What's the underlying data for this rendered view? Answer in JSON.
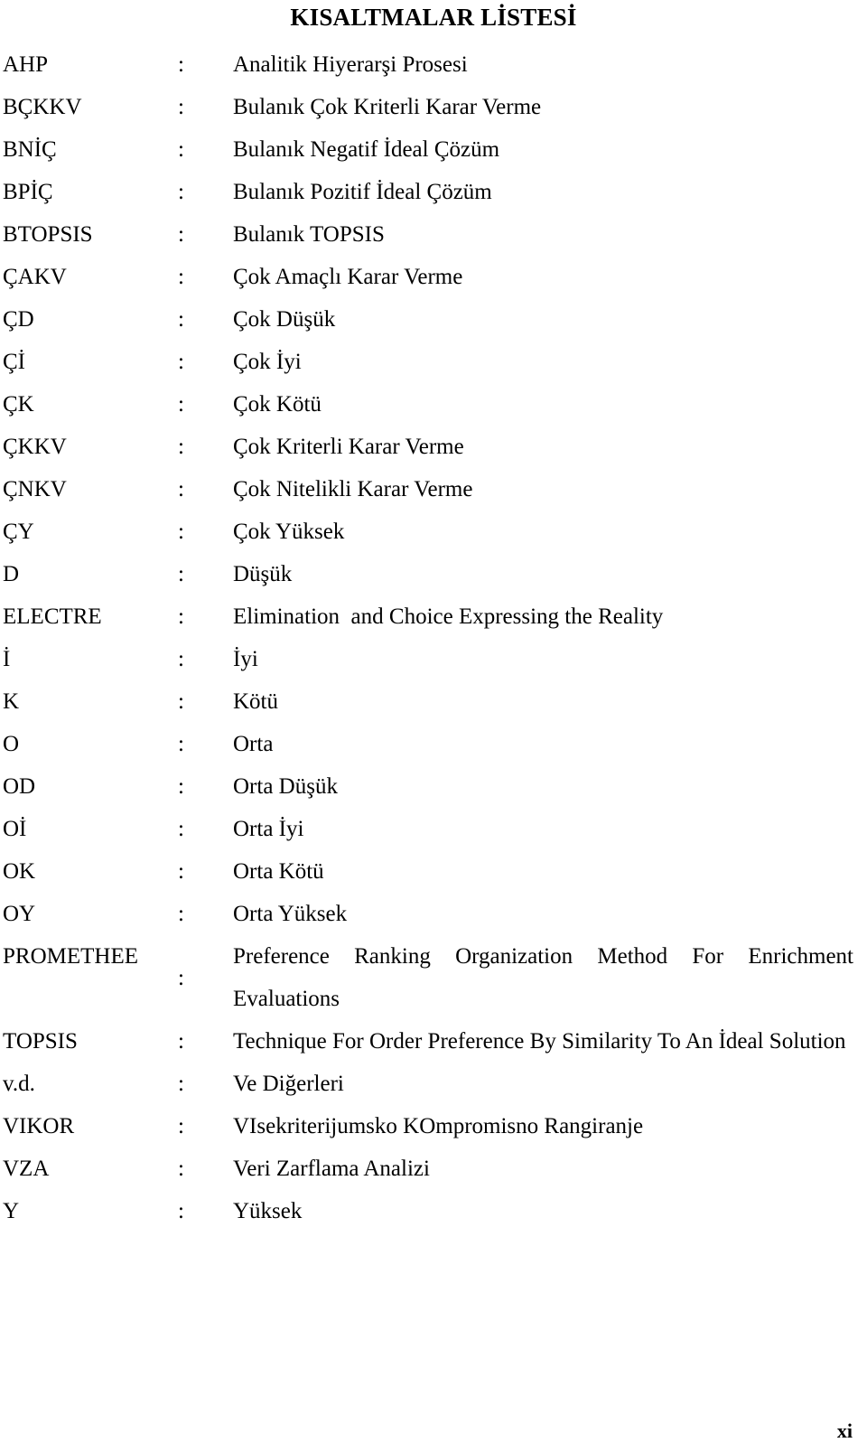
{
  "document": {
    "title": "KISALTMALAR LİSTESİ",
    "page_number": "xi",
    "separator": ":"
  },
  "entries": [
    {
      "term": "AHP",
      "definition": "Analitik Hiyerarşi Prosesi",
      "multiline": false
    },
    {
      "term": "BÇKKV",
      "definition": "Bulanık Çok Kriterli Karar Verme",
      "multiline": false
    },
    {
      "term": "BNİÇ",
      "definition": "Bulanık Negatif İdeal Çözüm",
      "multiline": false
    },
    {
      "term": "BPİÇ",
      "definition": "Bulanık Pozitif İdeal Çözüm",
      "multiline": false
    },
    {
      "term": "BTOPSIS",
      "definition": "Bulanık TOPSIS",
      "multiline": false
    },
    {
      "term": "ÇAKV",
      "definition": "Çok Amaçlı Karar Verme",
      "multiline": false
    },
    {
      "term": "ÇD",
      "definition": "Çok Düşük",
      "multiline": false
    },
    {
      "term": "Çİ",
      "definition": "Çok İyi",
      "multiline": false
    },
    {
      "term": "ÇK",
      "definition": "Çok Kötü",
      "multiline": false
    },
    {
      "term": "ÇKKV",
      "definition": "Çok Kriterli Karar Verme",
      "multiline": false
    },
    {
      "term": "ÇNKV",
      "definition": "Çok Nitelikli Karar Verme",
      "multiline": false
    },
    {
      "term": "ÇY",
      "definition": "Çok Yüksek",
      "multiline": false
    },
    {
      "term": "D",
      "definition": "Düşük",
      "multiline": false
    },
    {
      "term": "ELECTRE",
      "definition": "Elimination  and Choice Expressing the Reality",
      "multiline": false
    },
    {
      "term": "İ",
      "definition": "İyi",
      "multiline": false
    },
    {
      "term": "K",
      "definition": "Kötü",
      "multiline": false
    },
    {
      "term": "O",
      "definition": "Orta",
      "multiline": false
    },
    {
      "term": "OD",
      "definition": "Orta Düşük",
      "multiline": false
    },
    {
      "term": "Oİ",
      "definition": "Orta İyi",
      "multiline": false
    },
    {
      "term": "OK",
      "definition": "Orta Kötü",
      "multiline": false
    },
    {
      "term": "OY",
      "definition": "Orta Yüksek",
      "multiline": false
    },
    {
      "term": "PROMETHEE",
      "definition": "Preference Ranking Organization Method For Enrichment Evaluations",
      "multiline": true
    },
    {
      "term": "TOPSIS",
      "definition": "Technique For Order Preference By Similarity To An İdeal Solution",
      "multiline": true
    },
    {
      "term": "v.d.",
      "definition": "Ve Diğerleri",
      "multiline": false
    },
    {
      "term": "VIKOR",
      "definition": "VIsekriterijumsko KOmpromisno Rangiranje",
      "multiline": false
    },
    {
      "term": "VZA",
      "definition": "Veri Zarflama Analizi",
      "multiline": false
    },
    {
      "term": "Y",
      "definition": "Yüksek",
      "multiline": false
    }
  ]
}
